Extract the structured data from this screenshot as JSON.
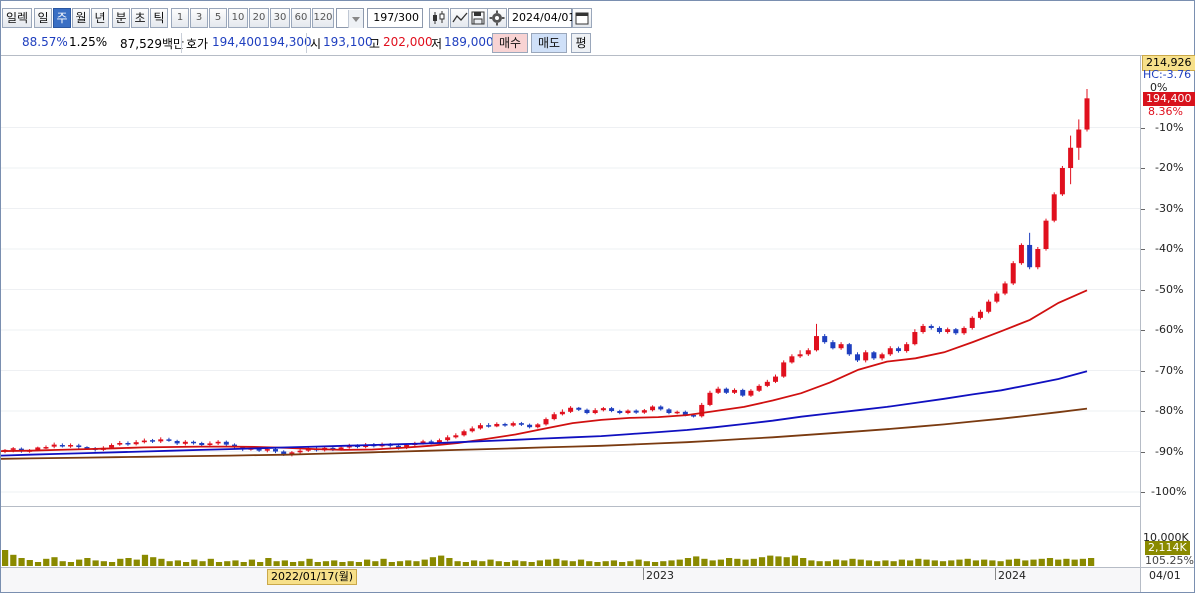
{
  "toolbar": {
    "first_label": "일렉",
    "periods": [
      "일",
      "주",
      "월",
      "년",
      "분",
      "초",
      "틱"
    ],
    "selected_period": "주",
    "intervals": [
      "1",
      "3",
      "5",
      "10",
      "20",
      "30",
      "60",
      "120"
    ],
    "count_display": "197/300",
    "date_value": "2024/04/01"
  },
  "quote": {
    "ratio1": "88.57%",
    "ratio2": "1.25%",
    "amount": "87,529백만",
    "hoga_label": "호가",
    "ask": "194,400",
    "bid": "194,300",
    "open_label": "시",
    "open": "193,100",
    "high_label": "고",
    "high": "202,000",
    "low_label": "저",
    "low": "189,000",
    "buy_label": "매수",
    "sell_label": "매도",
    "eval_label": "평"
  },
  "price_axis": {
    "top_price": "214,926",
    "hc_label": "HC:-3.76",
    "zero_label": "0%",
    "current_price": "194,400",
    "current_pct": "8.36%",
    "ticks": [
      "-10%",
      "-20%",
      "-30%",
      "-40%",
      "-50%",
      "-60%",
      "-70%",
      "-80%",
      "-90%",
      "-100%"
    ]
  },
  "volume_axis": {
    "top": "10,000K",
    "current": "2,114K",
    "pct": "105.25%"
  },
  "time_axis": {
    "cursor_date": "2022/01/17(월)",
    "label_2023": "2023",
    "label_2024": "2024",
    "right_date": "04/01"
  },
  "colors": {
    "up": "#e0101e",
    "down": "#1f3fbf",
    "ma_short": "#d01010",
    "ma_mid": "#1010c0",
    "ma_long": "#7a3a10",
    "volume": "#8a8a00"
  },
  "chart_data": {
    "type": "candlestick",
    "axis_range_pct": [
      -100,
      0
    ],
    "candles_pct": [
      [
        -89.8,
        -89.6,
        -90.4,
        -89.4
      ],
      [
        -89.6,
        -89.2,
        -90.2,
        -88.9
      ],
      [
        -89.3,
        -89.9,
        -90.3,
        -89.0
      ],
      [
        -89.9,
        -89.7,
        -90.3,
        -89.4
      ],
      [
        -89.6,
        -89.0,
        -89.9,
        -88.8
      ],
      [
        -89.0,
        -88.9,
        -89.4,
        -88.5
      ],
      [
        -88.8,
        -88.3,
        -89.2,
        -87.8
      ],
      [
        -88.4,
        -88.6,
        -89.0,
        -88.0
      ],
      [
        -88.7,
        -88.4,
        -89.1,
        -88.0
      ],
      [
        -88.5,
        -88.9,
        -89.3,
        -88.1
      ],
      [
        -88.9,
        -89.2,
        -89.6,
        -88.7
      ],
      [
        -89.2,
        -89.6,
        -90.0,
        -88.9
      ],
      [
        -89.6,
        -89.1,
        -89.9,
        -88.7
      ],
      [
        -89.0,
        -88.4,
        -89.3,
        -88.0
      ],
      [
        -88.3,
        -87.9,
        -88.6,
        -87.4
      ],
      [
        -87.9,
        -88.2,
        -88.6,
        -87.5
      ],
      [
        -88.2,
        -87.7,
        -88.5,
        -87.2
      ],
      [
        -87.7,
        -87.3,
        -88.0,
        -86.8
      ],
      [
        -87.2,
        -87.5,
        -87.9,
        -86.9
      ],
      [
        -87.5,
        -87.0,
        -87.9,
        -86.5
      ],
      [
        -87.0,
        -87.3,
        -87.6,
        -86.6
      ],
      [
        -87.4,
        -88.0,
        -88.4,
        -87.1
      ],
      [
        -88.1,
        -87.6,
        -88.5,
        -87.2
      ],
      [
        -87.6,
        -87.9,
        -88.3,
        -87.3
      ],
      [
        -87.9,
        -88.4,
        -88.8,
        -87.6
      ],
      [
        -88.4,
        -88.0,
        -88.7,
        -87.5
      ],
      [
        -88.0,
        -87.6,
        -88.4,
        -87.2
      ],
      [
        -87.6,
        -88.3,
        -88.7,
        -87.3
      ],
      [
        -88.3,
        -88.9,
        -89.3,
        -88.0
      ],
      [
        -89.0,
        -89.5,
        -89.9,
        -88.7
      ],
      [
        -89.5,
        -89.2,
        -89.8,
        -88.9
      ],
      [
        -89.2,
        -89.8,
        -90.1,
        -88.9
      ],
      [
        -89.8,
        -89.4,
        -90.2,
        -89.1
      ],
      [
        -89.4,
        -90.0,
        -90.4,
        -89.1
      ],
      [
        -90.0,
        -90.8,
        -91.1,
        -89.7
      ],
      [
        -90.8,
        -90.2,
        -91.2,
        -89.9
      ],
      [
        -90.2,
        -89.8,
        -90.6,
        -89.4
      ],
      [
        -89.8,
        -89.3,
        -90.1,
        -89.0
      ],
      [
        -89.3,
        -89.7,
        -90.0,
        -89.0
      ],
      [
        -89.7,
        -89.1,
        -90.0,
        -88.8
      ],
      [
        -89.1,
        -89.5,
        -89.9,
        -88.8
      ],
      [
        -89.5,
        -89.0,
        -89.8,
        -88.7
      ],
      [
        -89.0,
        -88.5,
        -89.3,
        -88.1
      ],
      [
        -88.5,
        -88.9,
        -89.2,
        -88.2
      ],
      [
        -88.9,
        -88.3,
        -89.2,
        -87.9
      ],
      [
        -88.3,
        -88.7,
        -89.0,
        -87.9
      ],
      [
        -88.7,
        -88.2,
        -89.0,
        -87.8
      ],
      [
        -88.2,
        -88.6,
        -89.0,
        -87.9
      ],
      [
        -88.6,
        -89.1,
        -89.5,
        -88.3
      ],
      [
        -89.1,
        -88.4,
        -89.4,
        -88.0
      ],
      [
        -88.4,
        -88.0,
        -88.7,
        -87.6
      ],
      [
        -88.0,
        -87.5,
        -88.3,
        -87.1
      ],
      [
        -87.5,
        -87.9,
        -88.2,
        -87.1
      ],
      [
        -87.9,
        -87.2,
        -88.2,
        -86.8
      ],
      [
        -87.2,
        -86.5,
        -87.5,
        -86.0
      ],
      [
        -86.5,
        -86.0,
        -86.8,
        -85.5
      ],
      [
        -86.0,
        -85.0,
        -86.3,
        -84.6
      ],
      [
        -85.0,
        -84.3,
        -85.3,
        -83.8
      ],
      [
        -84.3,
        -83.5,
        -84.6,
        -83.0
      ],
      [
        -83.5,
        -83.8,
        -84.1,
        -83.0
      ],
      [
        -83.8,
        -83.2,
        -84.0,
        -82.8
      ],
      [
        -83.2,
        -83.6,
        -83.9,
        -82.9
      ],
      [
        -83.6,
        -83.0,
        -83.9,
        -82.6
      ],
      [
        -83.0,
        -83.4,
        -83.7,
        -82.7
      ],
      [
        -83.4,
        -84.0,
        -84.3,
        -83.1
      ],
      [
        -84.0,
        -83.3,
        -84.3,
        -83.0
      ],
      [
        -83.3,
        -82.0,
        -83.6,
        -81.6
      ],
      [
        -82.0,
        -80.8,
        -82.3,
        -80.3
      ],
      [
        -80.8,
        -80.2,
        -81.1,
        -79.6
      ],
      [
        -80.2,
        -79.2,
        -80.5,
        -78.8
      ],
      [
        -79.2,
        -79.7,
        -80.0,
        -79.0
      ],
      [
        -79.7,
        -80.5,
        -80.8,
        -79.4
      ],
      [
        -80.5,
        -79.8,
        -80.8,
        -79.3
      ],
      [
        -79.8,
        -79.3,
        -80.1,
        -79.0
      ],
      [
        -79.3,
        -80.0,
        -80.3,
        -79.0
      ],
      [
        -80.0,
        -80.5,
        -80.8,
        -79.7
      ],
      [
        -80.5,
        -79.9,
        -80.8,
        -79.6
      ],
      [
        -79.9,
        -80.4,
        -80.7,
        -79.6
      ],
      [
        -80.4,
        -79.8,
        -80.7,
        -79.5
      ],
      [
        -79.8,
        -78.9,
        -80.1,
        -78.6
      ],
      [
        -78.9,
        -79.6,
        -79.9,
        -78.6
      ],
      [
        -79.6,
        -80.5,
        -80.8,
        -79.3
      ],
      [
        -80.5,
        -80.2,
        -80.8,
        -79.9
      ],
      [
        -80.2,
        -81.0,
        -81.3,
        -79.9
      ],
      [
        -81.0,
        -81.3,
        -81.6,
        -80.7
      ],
      [
        -81.3,
        -78.5,
        -81.6,
        -78.0
      ],
      [
        -78.5,
        -75.5,
        -78.8,
        -75.0
      ],
      [
        -75.5,
        -74.5,
        -75.8,
        -74.0
      ],
      [
        -74.5,
        -75.5,
        -75.8,
        -74.2
      ],
      [
        -75.5,
        -74.8,
        -75.8,
        -74.4
      ],
      [
        -74.8,
        -76.2,
        -76.5,
        -74.5
      ],
      [
        -76.2,
        -75.0,
        -76.5,
        -74.6
      ],
      [
        -75.0,
        -73.8,
        -75.3,
        -73.4
      ],
      [
        -73.8,
        -72.8,
        -74.1,
        -72.3
      ],
      [
        -72.8,
        -71.5,
        -73.1,
        -71.0
      ],
      [
        -71.5,
        -68.0,
        -71.8,
        -67.5
      ],
      [
        -68.0,
        -66.5,
        -68.3,
        -66.0
      ],
      [
        -66.5,
        -66.0,
        -66.9,
        -65.0
      ],
      [
        -66.0,
        -65.0,
        -66.4,
        -64.5
      ],
      [
        -65.0,
        -61.5,
        -65.3,
        -58.5
      ],
      [
        -61.5,
        -63.0,
        -63.4,
        -61.0
      ],
      [
        -63.0,
        -64.5,
        -64.8,
        -62.5
      ],
      [
        -64.5,
        -63.5,
        -64.9,
        -63.0
      ],
      [
        -63.5,
        -66.0,
        -66.4,
        -63.2
      ],
      [
        -66.0,
        -67.5,
        -67.9,
        -65.5
      ],
      [
        -67.5,
        -65.5,
        -68.0,
        -65.0
      ],
      [
        -65.5,
        -67.0,
        -67.4,
        -65.2
      ],
      [
        -67.0,
        -66.0,
        -67.5,
        -65.6
      ],
      [
        -66.0,
        -64.5,
        -66.4,
        -64.0
      ],
      [
        -64.5,
        -65.2,
        -65.6,
        -64.1
      ],
      [
        -65.2,
        -63.5,
        -65.6,
        -63.0
      ],
      [
        -63.5,
        -60.5,
        -63.8,
        -59.8
      ],
      [
        -60.5,
        -59.0,
        -60.9,
        -58.5
      ],
      [
        -59.0,
        -59.5,
        -59.9,
        -58.6
      ],
      [
        -59.5,
        -60.5,
        -60.9,
        -59.1
      ],
      [
        -60.5,
        -59.8,
        -60.9,
        -59.4
      ],
      [
        -59.8,
        -60.8,
        -61.2,
        -59.5
      ],
      [
        -60.8,
        -59.5,
        -61.2,
        -59.1
      ],
      [
        -59.5,
        -57.0,
        -59.9,
        -56.6
      ],
      [
        -57.0,
        -55.5,
        -57.4,
        -55.0
      ],
      [
        -55.5,
        -53.0,
        -55.9,
        -52.5
      ],
      [
        -53.0,
        -51.0,
        -53.4,
        -50.5
      ],
      [
        -51.0,
        -48.5,
        -51.4,
        -48.0
      ],
      [
        -48.5,
        -43.5,
        -48.9,
        -43.0
      ],
      [
        -43.5,
        -39.0,
        -43.9,
        -38.6
      ],
      [
        -39.0,
        -44.5,
        -45.0,
        -36.0
      ],
      [
        -44.5,
        -40.0,
        -45.0,
        -39.5
      ],
      [
        -40.0,
        -33.0,
        -40.4,
        -32.5
      ],
      [
        -33.0,
        -26.5,
        -33.4,
        -26.0
      ],
      [
        -26.5,
        -20.0,
        -26.9,
        -19.5
      ],
      [
        -20.0,
        -15.0,
        -24.0,
        -12.0
      ],
      [
        -15.0,
        -10.5,
        -18.0,
        -8.0
      ],
      [
        -10.5,
        -2.8,
        -11.0,
        -0.5
      ]
    ],
    "moving_averages_pct": {
      "short": [
        -89.9,
        -89.8,
        -89.6,
        -89.4,
        -89.2,
        -89.0,
        -88.9,
        -88.8,
        -88.8,
        -88.9,
        -89.1,
        -89.4,
        -89.6,
        -89.5,
        -89.1,
        -88.6,
        -87.9,
        -86.9,
        -85.8,
        -84.4,
        -83.0,
        -82.2,
        -81.7,
        -81.5,
        -81.0,
        -80.0,
        -79.0,
        -77.4,
        -75.6,
        -73.0,
        -69.8,
        -67.8,
        -67.0,
        -65.5,
        -63.0,
        -60.3,
        -57.5,
        -53.3,
        -50.2
      ],
      "mid": [
        -91.0,
        -90.8,
        -90.6,
        -90.4,
        -90.2,
        -90.0,
        -89.8,
        -89.6,
        -89.4,
        -89.2,
        -89.0,
        -88.8,
        -88.6,
        -88.4,
        -88.2,
        -88.0,
        -87.7,
        -87.4,
        -87.1,
        -86.8,
        -86.5,
        -86.2,
        -85.7,
        -85.2,
        -84.7,
        -84.0,
        -83.2,
        -82.4,
        -81.4,
        -80.6,
        -79.8,
        -79.0,
        -78.0,
        -77.0,
        -75.9,
        -74.9,
        -73.5,
        -72.1,
        -70.2
      ],
      "long": [
        -91.8,
        -91.7,
        -91.6,
        -91.5,
        -91.4,
        -91.3,
        -91.2,
        -91.1,
        -91.0,
        -90.9,
        -90.8,
        -90.6,
        -90.4,
        -90.2,
        -90.0,
        -89.8,
        -89.6,
        -89.4,
        -89.2,
        -89.0,
        -88.8,
        -88.6,
        -88.3,
        -88.0,
        -87.7,
        -87.3,
        -86.9,
        -86.5,
        -86.0,
        -85.5,
        -85.0,
        -84.5,
        -83.9,
        -83.3,
        -82.6,
        -81.9,
        -81.1,
        -80.3,
        -79.4
      ]
    },
    "volume_relative": [
      0.4,
      0.28,
      0.2,
      0.15,
      0.1,
      0.18,
      0.22,
      0.12,
      0.1,
      0.16,
      0.2,
      0.14,
      0.12,
      0.1,
      0.18,
      0.2,
      0.16,
      0.28,
      0.22,
      0.18,
      0.12,
      0.14,
      0.1,
      0.16,
      0.12,
      0.18,
      0.1,
      0.12,
      0.14,
      0.1,
      0.16,
      0.1,
      0.2,
      0.12,
      0.14,
      0.1,
      0.12,
      0.18,
      0.1,
      0.12,
      0.14,
      0.1,
      0.12,
      0.1,
      0.16,
      0.12,
      0.18,
      0.1,
      0.12,
      0.14,
      0.12,
      0.16,
      0.22,
      0.26,
      0.2,
      0.12,
      0.1,
      0.14,
      0.12,
      0.16,
      0.12,
      0.1,
      0.14,
      0.12,
      0.1,
      0.14,
      0.16,
      0.18,
      0.14,
      0.12,
      0.16,
      0.12,
      0.1,
      0.12,
      0.14,
      0.1,
      0.12,
      0.16,
      0.12,
      0.1,
      0.12,
      0.14,
      0.16,
      0.2,
      0.24,
      0.18,
      0.14,
      0.16,
      0.2,
      0.18,
      0.16,
      0.18,
      0.22,
      0.26,
      0.24,
      0.22,
      0.26,
      0.2,
      0.14,
      0.12,
      0.12,
      0.16,
      0.14,
      0.18,
      0.16,
      0.14,
      0.12,
      0.14,
      0.12,
      0.16,
      0.14,
      0.18,
      0.16,
      0.14,
      0.12,
      0.14,
      0.16,
      0.18,
      0.14,
      0.16,
      0.14,
      0.12,
      0.16,
      0.18,
      0.14,
      0.16,
      0.18,
      0.2,
      0.16,
      0.18,
      0.16,
      0.18,
      0.2
    ]
  }
}
